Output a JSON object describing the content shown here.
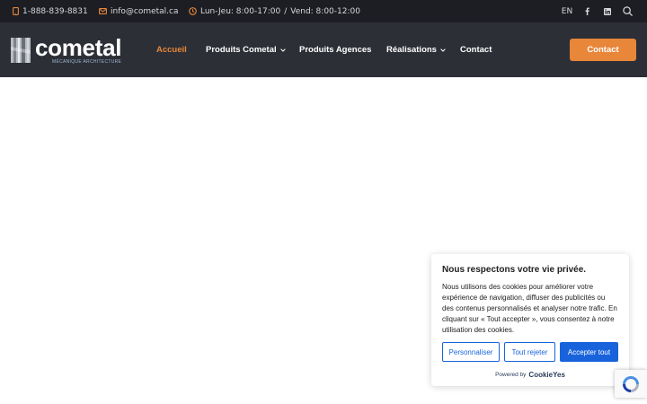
{
  "topbar": {
    "phone": "1-888-839-8831",
    "email": "info@cometal.ca",
    "hours_a": "Lun-Jeu: 8:00-17:00",
    "hours_sep": "/",
    "hours_b": "Vend: 8:00-12:00",
    "lang": "EN",
    "icons": [
      "phone-icon",
      "mail-icon",
      "clock-icon",
      "facebook-icon",
      "linkedin-icon",
      "search-icon"
    ]
  },
  "header": {
    "logo_name": "cometal",
    "logo_tagline": "MÉCANIQUE ARCHITECTURE",
    "nav": [
      {
        "label": "Accueil",
        "active": true
      },
      {
        "label": "Produits Cometal",
        "dropdown": true
      },
      {
        "label": "Produits Agences"
      },
      {
        "label": "Réalisations",
        "dropdown": true
      },
      {
        "label": "Contact"
      }
    ],
    "cta": "Contact"
  },
  "cookie": {
    "title": "Nous respectons votre vie privée.",
    "text": "Nous utilisons des cookies pour améliorer votre expérience de navigation, diffuser des publicités ou des contenus personnalisés et analyser notre trafic. En cliquant sur « Tout accepter », vous consentez à notre utilisation des cookies.",
    "customize": "Personnaliser",
    "reject": "Tout rejeter",
    "accept": "Accepter tout",
    "powered_by": "Powered by",
    "brand": "CookieYes"
  },
  "colors": {
    "topbar_bg": "#1c1e24",
    "header_bg": "#2c2f36",
    "accent": "#e8863a",
    "cookie_blue": "#1863dc"
  }
}
